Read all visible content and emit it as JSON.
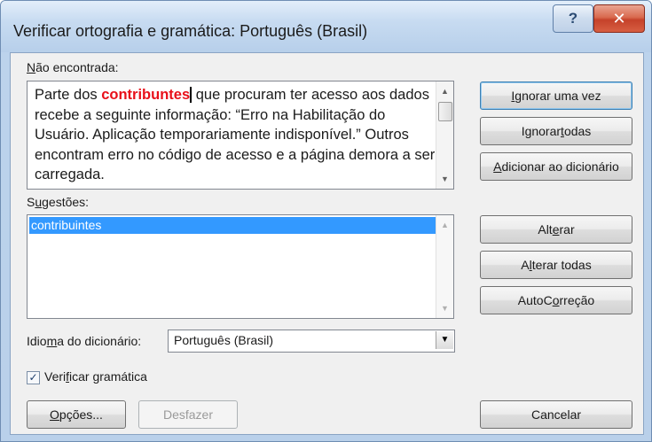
{
  "window": {
    "title": "Verificar ortografia e gramática: Português (Brasil)",
    "help_glyph": "?",
    "close_glyph": "✕"
  },
  "not_found": {
    "label_u": "N",
    "label_rest": "ão encontrada:",
    "text_before": "Parte dos ",
    "error_word": "contribuntes",
    "text_after": " que procuram ter acesso aos dados recebe a seguinte informação: “Erro na Habilitação do Usuário. Aplicação temporariamente indisponível.” Outros encontram erro no código de acesso e a página demora a ser carregada."
  },
  "suggestions": {
    "label_pre": "S",
    "label_u": "u",
    "label_rest": "gestões:",
    "items": [
      "contribuintes"
    ]
  },
  "buttons": {
    "ignore_once": {
      "u": "I",
      "rest": "gnorar uma vez"
    },
    "ignore_all": {
      "pre": "Ignorar ",
      "u": "t",
      "rest": "odas"
    },
    "add_dictionary": {
      "u": "A",
      "rest": "dicionar ao dicionário"
    },
    "change": {
      "pre": "Alt",
      "u": "e",
      "rest": "rar"
    },
    "change_all": {
      "pre": "A",
      "u": "l",
      "rest": "terar todas"
    },
    "autocorrect": {
      "pre": "AutoC",
      "u": "o",
      "rest": "rreção"
    },
    "options": {
      "u": "O",
      "rest": "pções..."
    },
    "undo": "Desfazer",
    "cancel": "Cancelar"
  },
  "dictionary": {
    "label_pre": "Idio",
    "label_u": "m",
    "label_rest": "a do dicionário:",
    "selected": "Português (Brasil)"
  },
  "grammar": {
    "label_pre": "Veri",
    "label_u": "f",
    "label_rest": "icar gramática",
    "checked": true,
    "check_glyph": "✓"
  },
  "icons": {
    "scroll_up": "▲",
    "scroll_down": "▼",
    "dropdown": "▼"
  },
  "colors": {
    "error_word": "#e8101a",
    "selection": "#3399ff",
    "close_button": "#c5422a"
  }
}
